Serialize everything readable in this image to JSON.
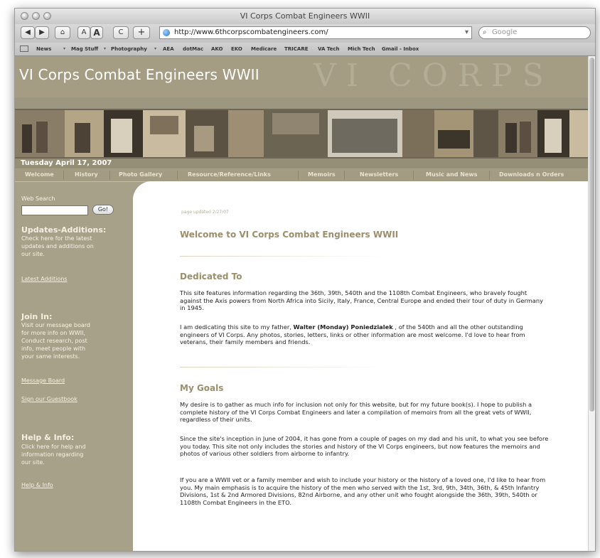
{
  "window": {
    "title": "VI Corps Combat Engineers WWII",
    "url": "http://www.6thcorpscombatengineers.com/",
    "search_placeholder": "Google",
    "toolbar": {
      "text_small": "A",
      "text_large": "A",
      "reload": "C",
      "add": "+"
    }
  },
  "bookmarks": [
    "News",
    "Mag Stuff",
    "Photography",
    "AEA",
    "dotMac",
    "AKO",
    "EKO",
    "Medicare",
    "TRICARE",
    "VA Tech",
    "Mich Tech",
    "Gmail - Inbox"
  ],
  "header": {
    "site_title": "VI Corps Combat Engineers WWII",
    "ghost_text": "VI CORPS",
    "date": "Tuesday April 17, 2007"
  },
  "nav": [
    "Welcome",
    "History",
    "Photo Gallery",
    "Resource/Reference/Links",
    "Memoirs",
    "Newsletters",
    "Music and News",
    "Downloads n Orders"
  ],
  "sidebar": {
    "web_search_label": "Web Search",
    "go_label": "Go!",
    "updates_heading": "Updates-Additions:",
    "updates_text": [
      "Check here for the latest",
      "updates and additions on",
      "our site."
    ],
    "updates_link": "Latest Additions",
    "join_heading": "Join In:",
    "join_text": [
      "Visit our message board",
      "for more info on WWII,",
      "Conduct research, post",
      "info, meet people with",
      "your same interests."
    ],
    "message_board_link": "Message Board",
    "guestbook_link": "Sign our Guestbook",
    "help_heading": "Help & Info:",
    "help_text": [
      "Click here for help and",
      "information regarding",
      "our site."
    ],
    "help_link": "Help & Info"
  },
  "content": {
    "updated": "page updated 2/27/07",
    "welcome_title": "Welcome to VI Corps Combat Engineers WWII",
    "dedicated_title": "Dedicated To",
    "dedicated_p1": "This site features information regarding the 36th, 39th, 540th and the 1108th Combat Engineers, who bravely fought against the Axis powers from North Africa into Sicily, Italy, France, Central Europe and ended their tour of duty in Germany in 1945.",
    "dedicated_p2_before": "I am dedicating this site to my father, ",
    "dedicated_p2_name": "Walter (Monday) Poniedzialek",
    "dedicated_p2_after": " , of the 540th and all the other outstanding engineers of VI Corps. Any photos, stories, letters, links or other information are most welcome. I'd love to hear from veterans, their family members and friends.",
    "goals_title": "My Goals",
    "goals_p1": "My desire is to gather as much info for inclusion not only for this website, but for my future book(s). I hope to publish a complete history of the VI Corps Combat Engineers and later a compilation of memoirs from all the great vets of WWII, regardless of their units.",
    "goals_p2": "Since the site's inception in June of 2004, it has gone from a couple of pages on my dad and his unit, to what you see before you today. This site not only includes the stories and history of the VI Corps engineers, but now features the memoirs and photos of various other soldiers from airborne to infantry.",
    "goals_p3": "If you are a WWII vet or a family member and wish to include your history or the history of a loved one, I'd like to hear from you. My main emphasis is to acquire the history of the men who served with the 1st, 3rd, 9th, 34th, 36th, & 45th Infantry Divisions, 1st & 2nd Armored Divisions, 82nd Airborne, and any other unit who fought alongside the 36th, 39th, 540th or 1108th Combat Engineers in the ETO."
  }
}
